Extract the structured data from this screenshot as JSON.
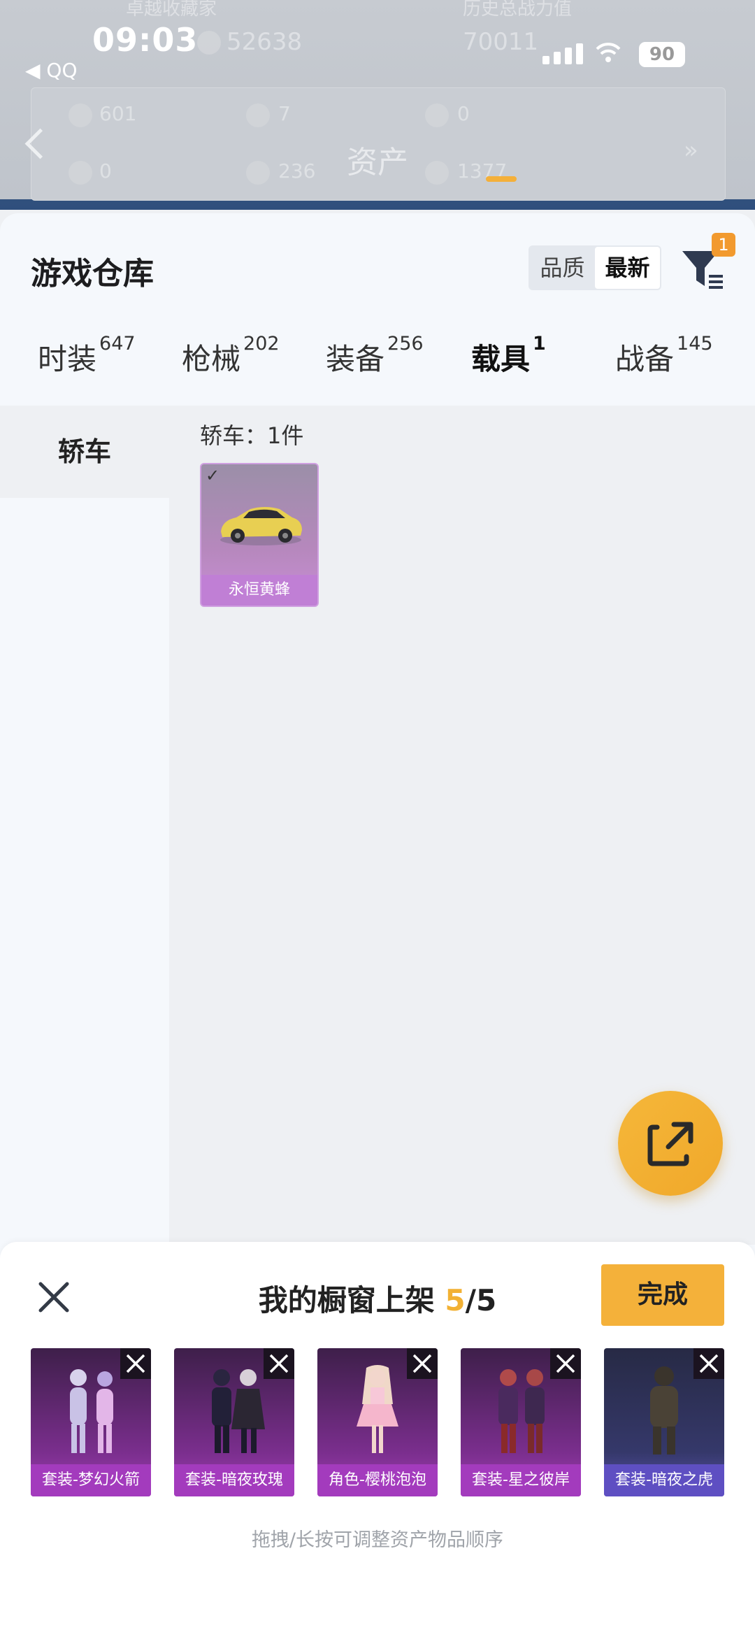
{
  "status_bar": {
    "time": "09:03",
    "back_app": "◀ QQ",
    "battery": "90"
  },
  "header": {
    "title": "资产",
    "ghost_labels": [
      "卓越收藏家",
      "历史总战力值"
    ],
    "ghost_values": [
      "52638",
      "70011"
    ],
    "asset_counts": [
      "601",
      "7",
      "0",
      "0",
      "236",
      "1377"
    ]
  },
  "sheet": {
    "title": "游戏仓库",
    "sort_options": [
      "品质",
      "最新"
    ],
    "sort_selected": "最新",
    "filter_badge": "1"
  },
  "tabs": [
    {
      "label": "时装",
      "count": "647"
    },
    {
      "label": "枪械",
      "count": "202"
    },
    {
      "label": "装备",
      "count": "256"
    },
    {
      "label": "载具",
      "count": "1",
      "active": true
    },
    {
      "label": "战备",
      "count": "145"
    }
  ],
  "category": {
    "selected": "轿车",
    "count_label": "轿车：1件"
  },
  "items": [
    {
      "name": "永恒黄蜂",
      "icon": "car-icon"
    }
  ],
  "showcase": {
    "title_prefix": "我的橱窗上架 ",
    "current": "5",
    "total": "/5",
    "done_label": "完成",
    "slots": [
      {
        "label": "套装-梦幻火箭"
      },
      {
        "label": "套装-暗夜玫瑰"
      },
      {
        "label": "角色-樱桃泡泡"
      },
      {
        "label": "套装-星之彼岸"
      },
      {
        "label": "套装-暗夜之虎"
      }
    ],
    "hint": "拖拽/长按可调整资产物品顺序"
  },
  "colors": {
    "accent": "#f4b13a",
    "purple": "#a33bbd",
    "badge": "#f29a2e"
  }
}
